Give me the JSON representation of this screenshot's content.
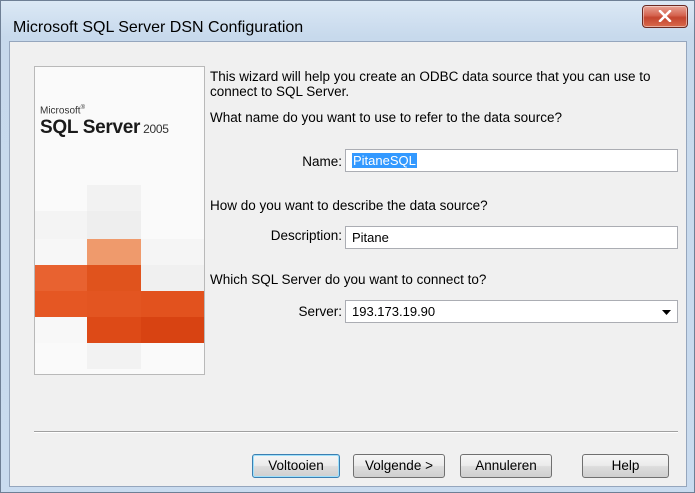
{
  "window": {
    "title": "Microsoft SQL Server DSN Configuration"
  },
  "banner": {
    "brand_small": "Microsoft",
    "brand_main": "SQL Server",
    "brand_version": "2005"
  },
  "intro": "This wizard will help you create an ODBC data source that you can use to connect to SQL Server.",
  "name_section": {
    "question": "What name do you want to use to refer to the data source?",
    "label": "Name:",
    "value": "PitaneSQL"
  },
  "desc_section": {
    "question": "How do you want to describe the data source?",
    "label": "Description:",
    "value": "Pitane"
  },
  "server_section": {
    "question": "Which SQL Server do you want to connect to?",
    "label": "Server:",
    "value": "193.173.19.90"
  },
  "buttons": {
    "finish": "Voltooien",
    "next": "Volgende >",
    "cancel": "Annuleren",
    "help": "Help"
  },
  "colors": {
    "accent_orange": "#e0531d",
    "selection_blue": "#3399ff",
    "close_red": "#c4452f"
  }
}
